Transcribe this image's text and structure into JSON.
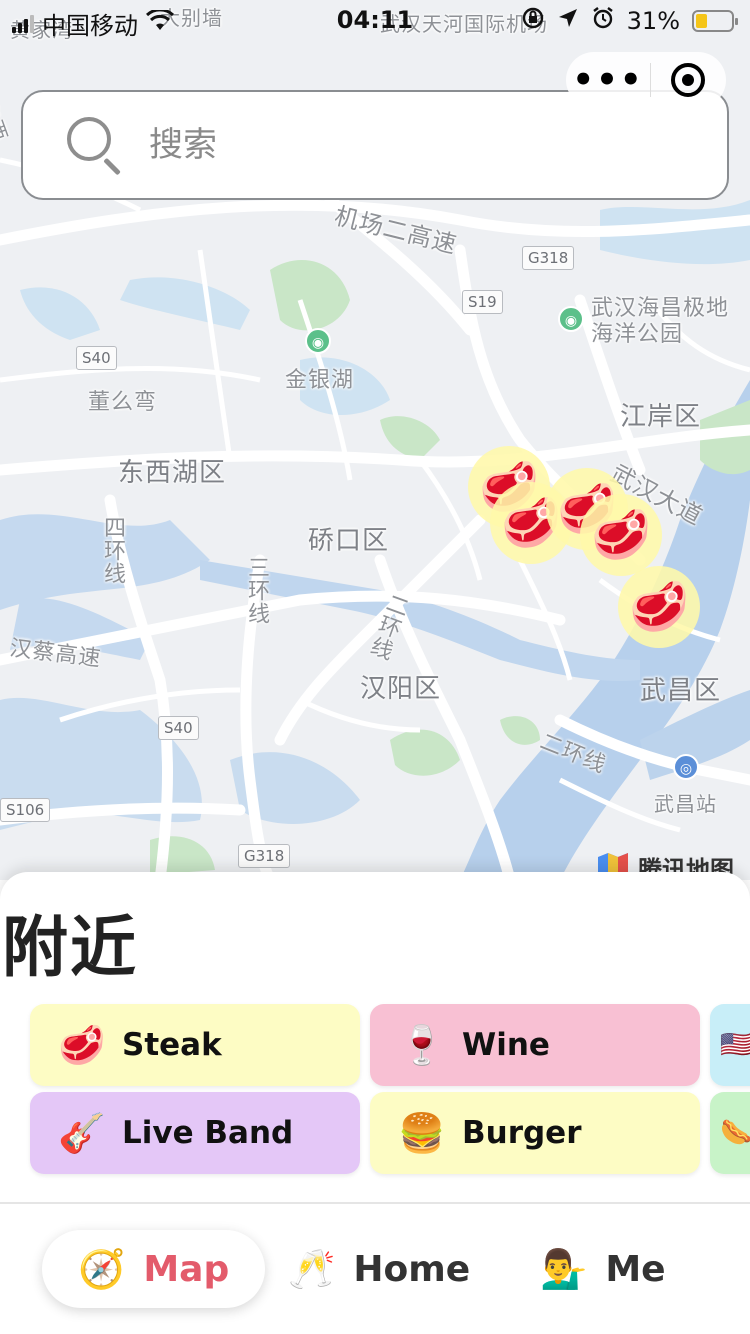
{
  "status_bar": {
    "carrier": "中国移动",
    "time": "04:11",
    "battery": "31%",
    "battery_level": 0.31
  },
  "capsule": {
    "more_icon": "more-dots-icon",
    "close_icon": "target-icon"
  },
  "search": {
    "placeholder": "搜索"
  },
  "map": {
    "labels": {
      "airport_highway": "机场二高速",
      "haichang": "武汉海昌极地\n海洋公园",
      "jinyinhu": "金银湖",
      "dongmawan": "董么弯",
      "jianganqu": "江岸区",
      "dongxihu": "东西湖区",
      "wuhan_avenue": "武汉大道",
      "qiaokou": "硚口区",
      "ring4": "四环线",
      "ring3": "三环线",
      "ring2_a": "二环线",
      "hancai": "汉蔡高速",
      "hanyang": "汉阳区",
      "wuchang": "武昌区",
      "ring2_b": "二环线",
      "wuchang_station": "武昌站",
      "top_left_fragment": "黄家湾",
      "top_dabie": "大别墙",
      "top_airport": "武汉天河国际机场",
      "left_fragment": "东西"
    },
    "shields": {
      "g318_top": "G318",
      "s19": "S19",
      "s40_top": "S40",
      "s40_bottom": "S40",
      "s106": "S106",
      "g318_bottom": "G318"
    },
    "marker_icon": "🥩",
    "brand": "腾讯地图"
  },
  "sheet": {
    "title": "附近",
    "categories": [
      {
        "emoji": "🥩",
        "label": "Steak",
        "color": "#fdfcc4"
      },
      {
        "emoji": "🍷",
        "label": "Wine",
        "color": "#f8c0d3"
      },
      {
        "emoji": "🇺🇸",
        "label": "",
        "color": "#c8eef8"
      },
      {
        "emoji": "🎸",
        "label": "Live Band",
        "color": "#e4c7f7"
      },
      {
        "emoji": "🍔",
        "label": "Burger",
        "color": "#fdfcc4"
      },
      {
        "emoji": "🌭",
        "label": "",
        "color": "#c8f3c8"
      }
    ]
  },
  "nav": {
    "items": [
      {
        "emoji": "🧭",
        "label": "Map",
        "active": true
      },
      {
        "emoji": "🥂",
        "label": "Home",
        "active": false
      },
      {
        "emoji": "💁‍♂️",
        "label": "Me",
        "active": false
      }
    ]
  },
  "colors": {
    "active_nav": "#e35b6b",
    "water": "#b9d3ee",
    "park": "#c9e8c4"
  }
}
